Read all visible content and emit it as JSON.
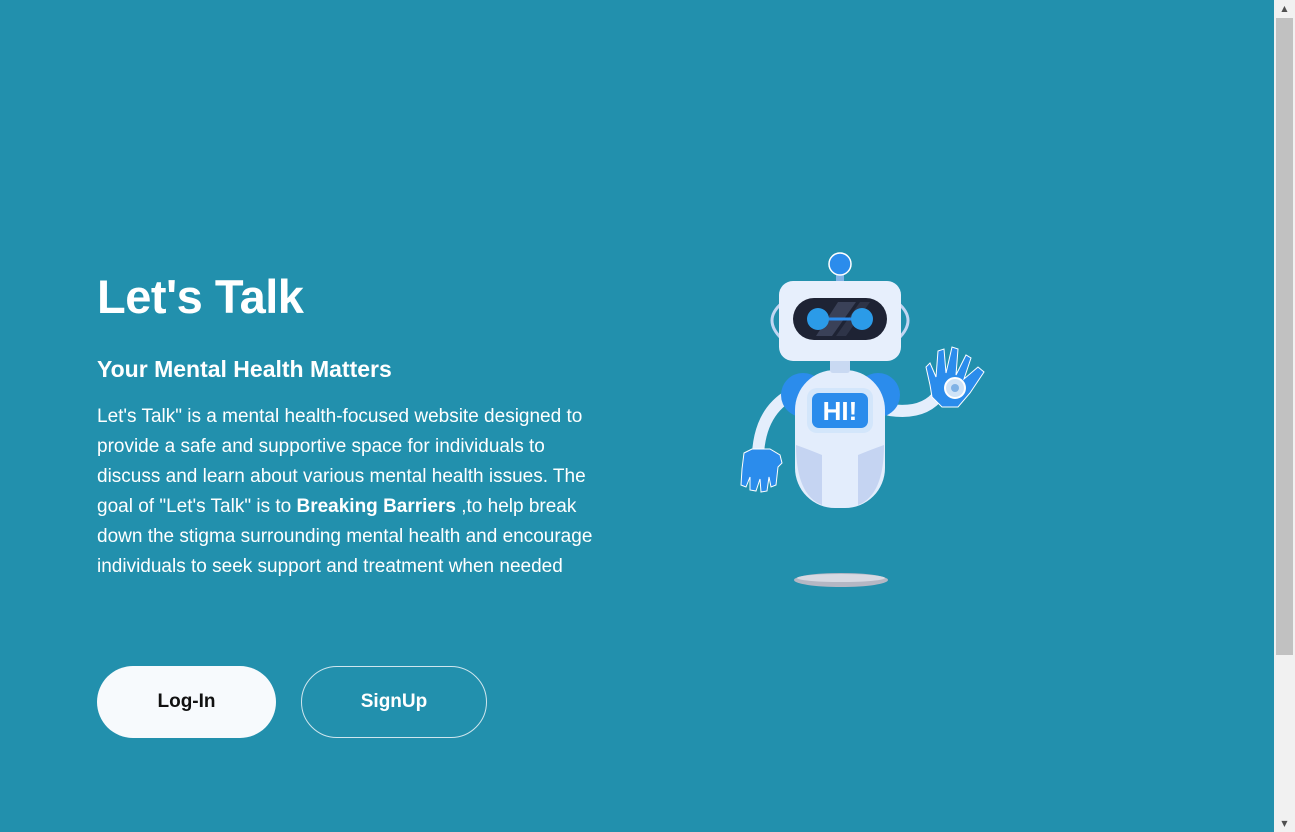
{
  "hero": {
    "title": "Let's Talk",
    "subtitle": "Your Mental Health Matters",
    "description_part1": "Let's Talk\" is a mental health-focused website designed to provide a safe and supportive space for individuals to discuss and learn about various mental health issues. The goal of \"Let's Talk\" is to ",
    "description_highlight": "Breaking Barriers",
    "description_part2": " ,to help break down the stigma surrounding mental health and encourage individuals to seek support and treatment when needed"
  },
  "buttons": {
    "login_label": "Log-In",
    "signup_label": "SignUp"
  },
  "illustration": {
    "badge_text": "HI!",
    "icon": "waving-robot-icon"
  },
  "colors": {
    "background": "#2290ad",
    "text": "#ffffff",
    "login_button_bg": "#f7fafd",
    "robot_accent": "#1e88e5"
  },
  "scrollbar": {
    "up_icon": "scroll-up-arrow-icon",
    "down_icon": "scroll-down-arrow-icon"
  }
}
